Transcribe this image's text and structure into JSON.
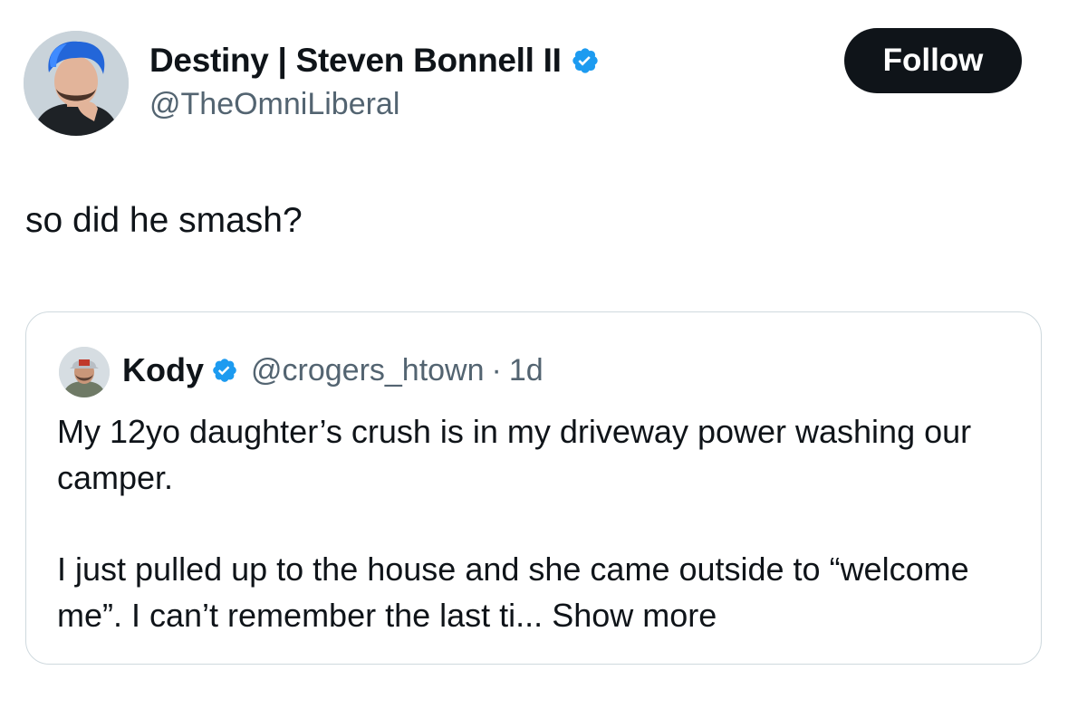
{
  "post": {
    "author": {
      "name": "Destiny | Steven Bonnell II",
      "handle": "@TheOmniLiberal",
      "verified": true,
      "avatar_icon": "user-avatar"
    },
    "follow_label": "Follow",
    "text": "so did he smash?"
  },
  "quoted_post": {
    "author": {
      "name": "Kody",
      "handle": "@crogers_htown",
      "verified": true,
      "avatar_icon": "user-avatar"
    },
    "separator": "·",
    "timestamp": "1d",
    "paragraphs": [
      "My 12yo daughter’s crush is in my driveway power washing our camper.",
      "I just pulled up to the house and she came outside to “welcome me”. I can’t  remember the last ti..."
    ],
    "show_more_label": "Show more"
  },
  "colors": {
    "text_primary": "#0f1419",
    "text_secondary": "#536471",
    "verified_blue": "#1d9bf0",
    "follow_button_bg": "#0f1419",
    "border": "#cfd9de"
  }
}
